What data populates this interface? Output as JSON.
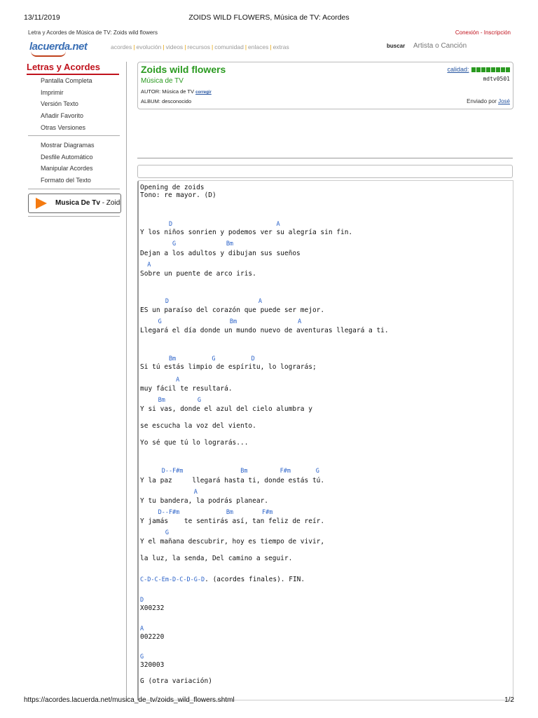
{
  "print_header": {
    "date": "13/11/2019",
    "title": "ZOIDS WILD FLOWERS, Música de TV: Acordes"
  },
  "topbar": {
    "breadcrumb": "Letra y Acordes de Música de TV: Zoids wild flowers",
    "login": "Conexión - Inscripción"
  },
  "logo": "lacuerda.net",
  "nav": [
    "acordes",
    "evolución",
    "videos",
    "recursos",
    "comunidad",
    "enlaces",
    "extras"
  ],
  "search": {
    "label": "buscar",
    "placeholder": "Artista o Canción"
  },
  "sidebar": {
    "title": "Letras y Acordes",
    "group1": [
      "Pantalla Completa",
      "Imprimir",
      "Versión Texto",
      "Añadir Favorito",
      "Otras Versiones"
    ],
    "group2": [
      "Mostrar Diagramas",
      "Desfile Automático",
      "Manipular Acordes",
      "Formato del Texto"
    ],
    "radio": {
      "name": "Musica De Tv",
      "rest": " - Zoids wild flowers"
    }
  },
  "song": {
    "title": "Zoids wild flowers",
    "artist": "Música de TV",
    "autor_label": "AUTOR:",
    "autor": "Música de TV",
    "corregir": "corregir",
    "album_label": "ALBUM:",
    "album": "desconocido",
    "calidad_label": "calidad:",
    "calidad_level": 8,
    "calidad_max": 8,
    "code": "mdtv0501",
    "enviado_label": "Enviado por",
    "enviado_user": "José"
  },
  "lyrics": [
    {
      "k": "lyric",
      "t": "Opening de zoids"
    },
    {
      "k": "lyric",
      "t": "Tono: re mayor. (D)"
    },
    {
      "k": "chord",
      "t": "        D                             A"
    },
    {
      "k": "lyric",
      "t": "Y los niños sonrien y podemos ver su alegría sin fin."
    },
    {
      "k": "chord",
      "t": "         G              Bm"
    },
    {
      "k": "lyric",
      "t": "Dejan a los adultos y dibujan sus sueños"
    },
    {
      "k": "chord",
      "t": "  A"
    },
    {
      "k": "lyric",
      "t": "Sobre un puente de arco iris."
    },
    {
      "k": "chord",
      "t": "       D                         A"
    },
    {
      "k": "lyric",
      "t": "ES un paraíso del corazón que puede ser mejor."
    },
    {
      "k": "chord",
      "t": "     G                   Bm                 A"
    },
    {
      "k": "lyric",
      "t": "Llegará el día donde un mundo nuevo de aventuras llegará a ti."
    },
    {
      "k": "chord",
      "t": "        Bm          G          D"
    },
    {
      "k": "lyric",
      "t": "Si tú estás limpio de espíritu, lo lograrás;"
    },
    {
      "k": "chord",
      "t": "          A"
    },
    {
      "k": "lyric",
      "t": "muy fácil te resultará."
    },
    {
      "k": "chord",
      "t": "     Bm         G"
    },
    {
      "k": "lyric",
      "t": "Y si vas, donde el azul del cielo alumbra y"
    },
    {
      "k": "lyric",
      "t": "se escucha la voz del viento."
    },
    {
      "k": "lyric",
      "t": "Yo sé que tú lo lograrás..."
    },
    {
      "k": "chord",
      "t": "      D--F#m                Bm         F#m       G"
    },
    {
      "k": "lyric",
      "t": "Y la paz     llegará hasta ti, donde estás tú."
    },
    {
      "k": "chord",
      "t": "               A"
    },
    {
      "k": "lyric",
      "t": "Y tu bandera, la podrás planear."
    },
    {
      "k": "chord",
      "t": "     D--F#m             Bm        F#m"
    },
    {
      "k": "lyric",
      "t": "Y jamás    te sentirás así, tan feliz de reír."
    },
    {
      "k": "chord",
      "t": "       G"
    },
    {
      "k": "lyric",
      "t": "Y el mañana descubrir, hoy es tiempo de vivir,"
    },
    {
      "k": "lyric",
      "t": "la luz, la senda, Del camino a seguir."
    },
    {
      "k": "mixed",
      "c": "C-D-C-Em-D-C-D-G-D",
      "t": ". (acordes finales). FIN."
    },
    {
      "k": "chord",
      "t": "D"
    },
    {
      "k": "lyric",
      "t": "X00232"
    },
    {
      "k": "chord",
      "t": "A"
    },
    {
      "k": "lyric",
      "t": "002220"
    },
    {
      "k": "chord",
      "t": "G"
    },
    {
      "k": "lyric",
      "t": "320003"
    },
    {
      "k": "lyric",
      "t": "G (otra variación)"
    }
  ],
  "footer": {
    "url": "https://acordes.lacuerda.net/musica_de_tv/zoids_wild_flowers.shtml",
    "page": "1/2"
  }
}
